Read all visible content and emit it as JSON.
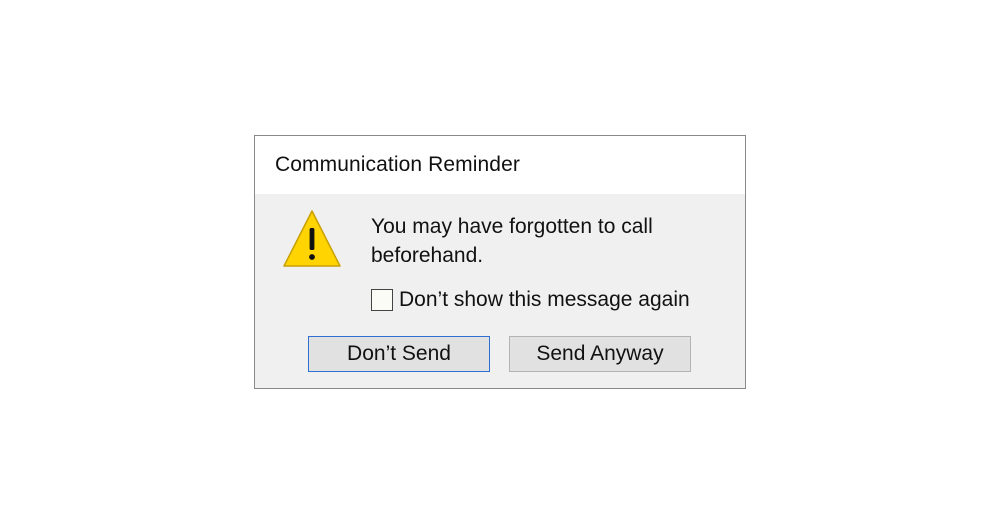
{
  "dialog": {
    "title": "Communication Reminder",
    "icon": "warning-icon",
    "message": "You may have forgotten to call beforehand.",
    "checkbox": {
      "label": "Don’t show this message again",
      "checked": false
    },
    "buttons": {
      "primary": "Don’t Send",
      "secondary": "Send Anyway"
    }
  },
  "colors": {
    "warning_fill": "#ffd400",
    "warning_stroke": "#c8a000",
    "dialog_body": "#f0f0f0",
    "focus_border": "#2f6fcf"
  }
}
